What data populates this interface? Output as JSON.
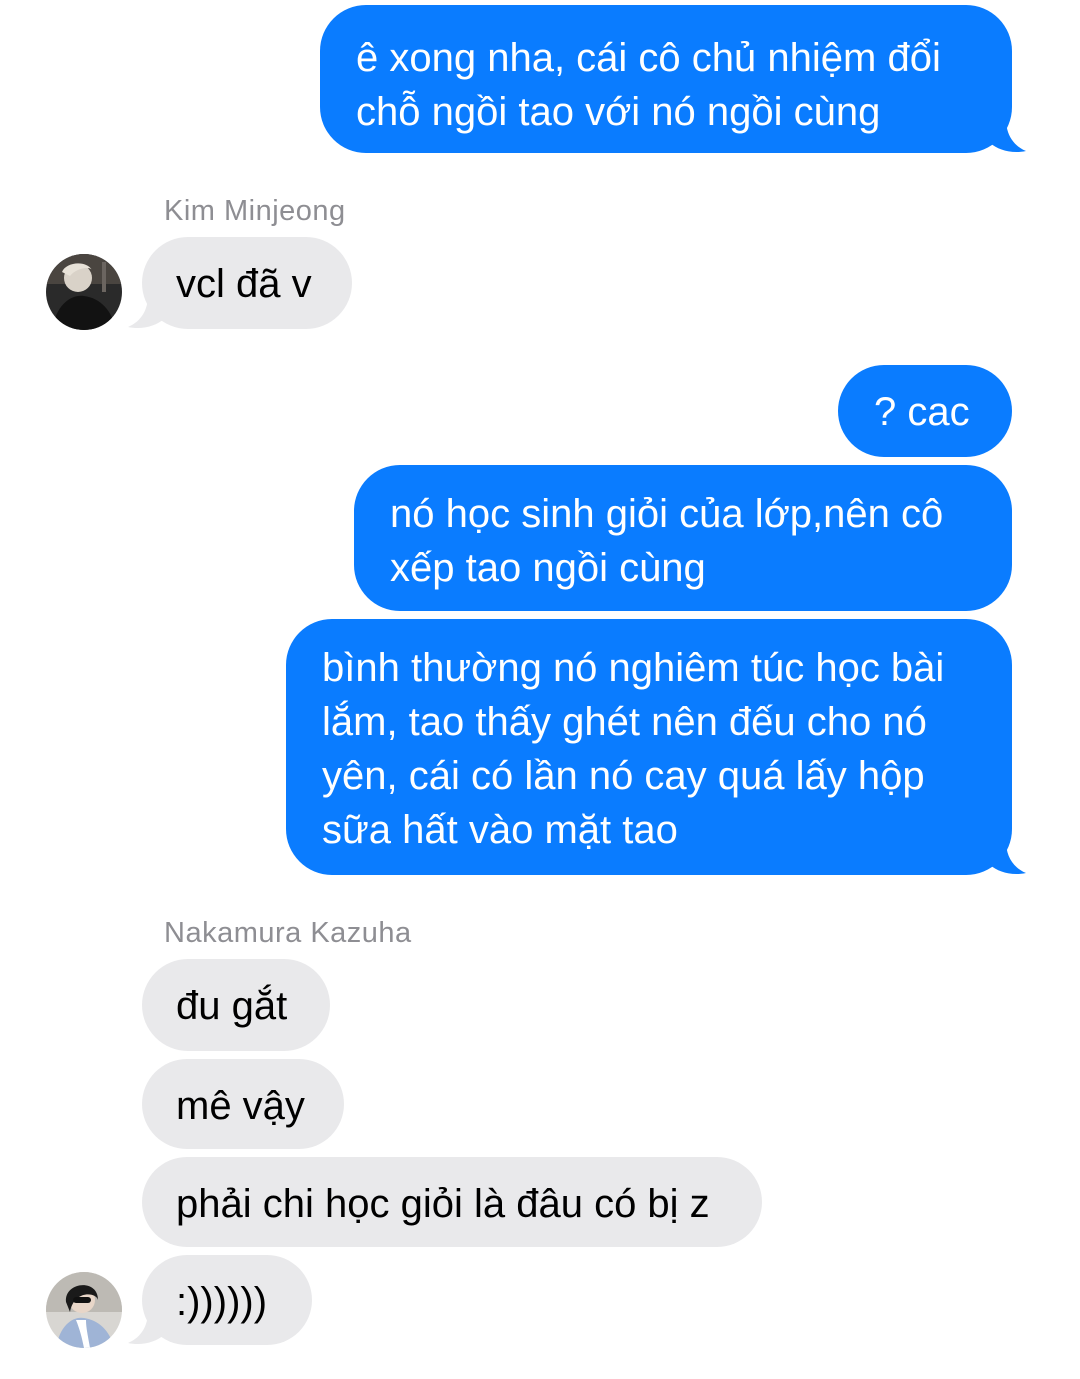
{
  "conversation": {
    "messages": [
      {
        "text": "ê xong nha, cái cô chủ nhiệm đổi chỗ ngồi tao với nó ngồi cùng"
      },
      {
        "text": "vcl đã v"
      },
      {
        "text": "? cac"
      },
      {
        "text": "nó học sinh giỏi của lớp,nên cô xếp tao ngồi cùng"
      },
      {
        "text": "bình thường nó nghiêm túc học bài lắm, tao thấy ghét nên đếu cho nó yên, cái có lần nó cay quá lấy hộp sữa hất vào mặt tao"
      },
      {
        "text": "đu gắt"
      },
      {
        "text": "mê vậy"
      },
      {
        "text": "phải chi học giỏi là đâu có bị z"
      },
      {
        "text": ":))))))"
      }
    ],
    "senders": [
      "Kim Minjeong",
      "Nakamura Kazuha"
    ]
  },
  "colors": {
    "outgoing_bubble": "#0a7cff",
    "incoming_bubble": "#e9e9eb",
    "sender_name": "#8e8e93"
  }
}
